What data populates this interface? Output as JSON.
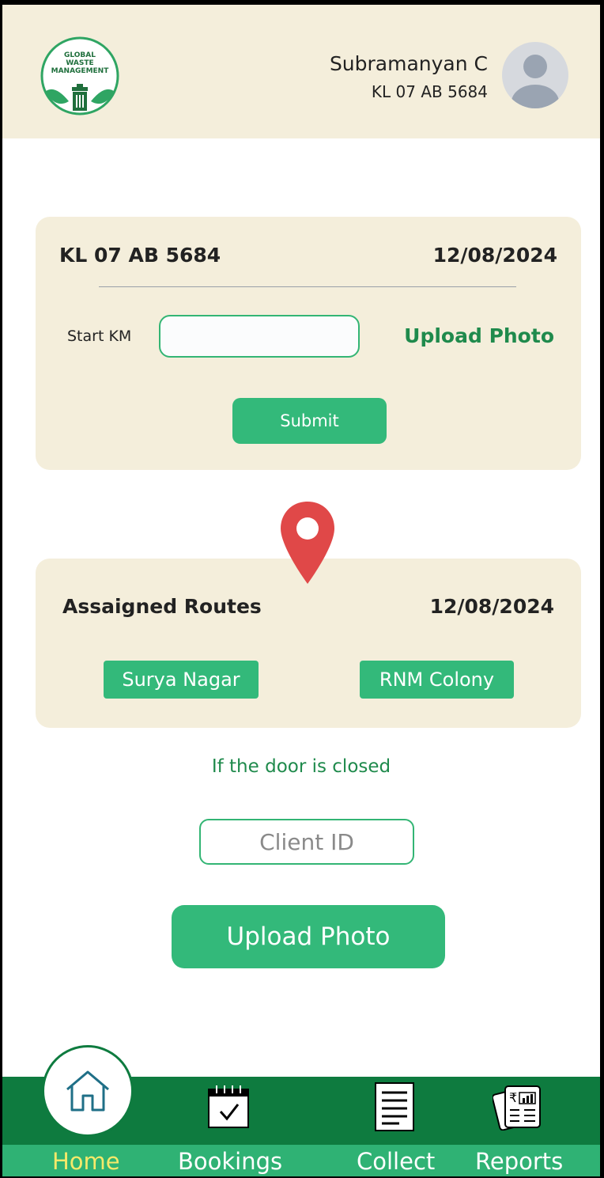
{
  "header": {
    "logo_lines": [
      "GLOBAL",
      "WASTE",
      "MANAGEMENT"
    ],
    "user_name": "Subramanyan C",
    "vehicle_number": "KL 07 AB 5684"
  },
  "start_card": {
    "vehicle": "KL 07 AB 5684",
    "date": "12/08/2024",
    "start_km_label": "Start KM",
    "start_km_value": "",
    "upload_label": "Upload Photo",
    "submit_label": "Submit"
  },
  "routes_card": {
    "title": "Assaigned Routes",
    "date": "12/08/2024",
    "routes": [
      "Surya Nagar",
      "RNM Colony"
    ]
  },
  "closed_door": {
    "prompt": "If the door is closed",
    "client_placeholder": "Client ID",
    "upload_label": "Upload Photo"
  },
  "nav": {
    "items": [
      {
        "label": "Home",
        "icon": "home-icon",
        "active": true
      },
      {
        "label": "Bookings",
        "icon": "calendar-check-icon",
        "active": false
      },
      {
        "label": "Collect",
        "icon": "document-icon",
        "active": false
      },
      {
        "label": "Reports",
        "icon": "rupee-report-icon",
        "active": false
      }
    ]
  },
  "colors": {
    "cream": "#f4eedb",
    "green": "#33b97a",
    "dark_green": "#0e7b3f",
    "active_nav": "#f6e96a",
    "pin_red": "#e04848"
  }
}
